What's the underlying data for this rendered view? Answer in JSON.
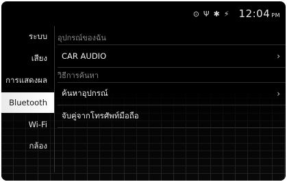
{
  "status": {
    "icons": [
      "media-icon",
      "usb-icon",
      "bluetooth-icon",
      "signal-icon"
    ],
    "time": "12:04",
    "ampm": "PM"
  },
  "sidebar": {
    "items": [
      {
        "label": "ระบบ"
      },
      {
        "label": "เสียง"
      },
      {
        "label": "การแสดงผล"
      },
      {
        "label": "Bluetooth",
        "active": true
      },
      {
        "label": "Wi-Fi"
      },
      {
        "label": "กล้อง"
      }
    ]
  },
  "main": {
    "my_devices_header": "อุปกรณ์ของฉัน",
    "device_name": "CAR AUDIO",
    "search_header": "วิธีการค้นหา",
    "search_devices": "ค้นหาอุปกรณ์",
    "pair_from_phone": "จับคู่จากโทรศัพท์มือถือ"
  }
}
